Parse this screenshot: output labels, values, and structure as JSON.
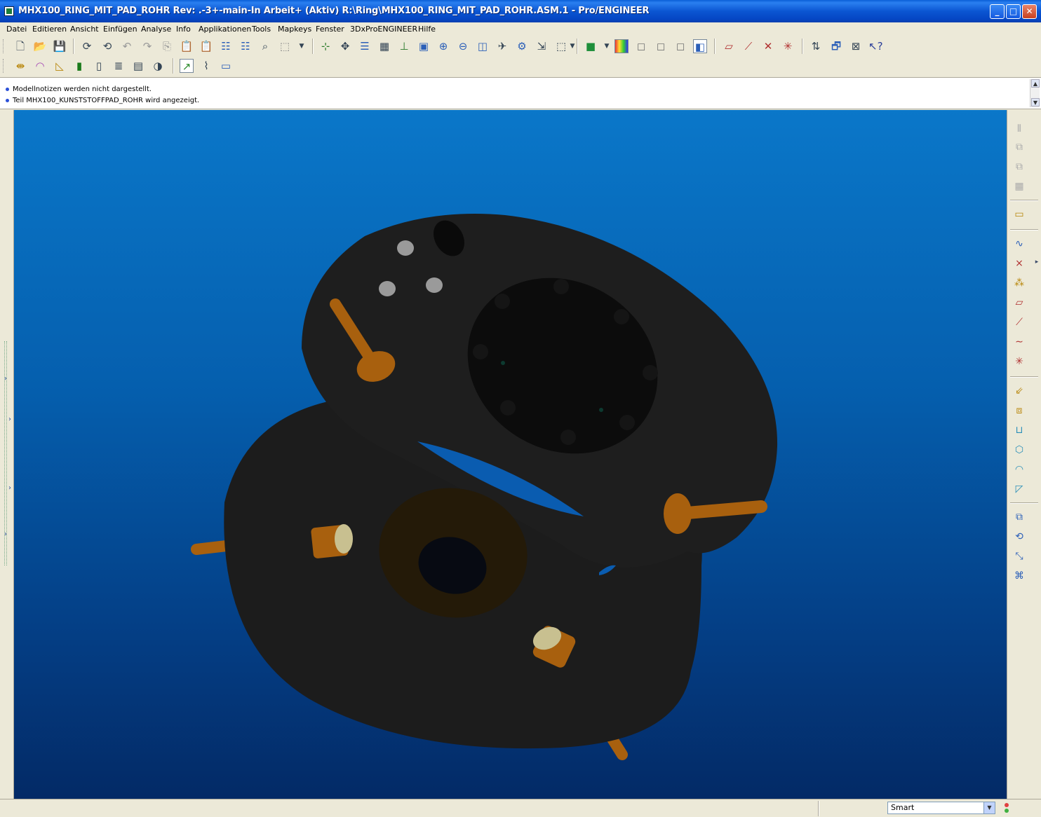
{
  "window": {
    "title": "MHX100_RING_MIT_PAD_ROHR Rev: .-3+-main-In Arbeit+ (Aktiv) R:\\Ring\\MHX100_RING_MIT_PAD_ROHR.ASM.1 - Pro/ENGINEER",
    "minimize": "_",
    "maximize": "□",
    "close": "✕"
  },
  "menu": {
    "items": [
      "Datei",
      "Editieren",
      "Ansicht",
      "Einfügen",
      "Analyse",
      "Info",
      "Applikationen",
      "Tools",
      "Mapkeys",
      "Fenster",
      "3DxProENGINEER",
      "Hilfe"
    ]
  },
  "messages": [
    "Modellnotizen werden nicht dargestellt.",
    "Teil MHX100_KUNSTSTOFFPAD_ROHR wird angezeigt."
  ],
  "statusbar": {
    "filter_value": "Smart",
    "filter_arrow": "▼"
  },
  "colors": {
    "viewport_top": "#0a77c9",
    "viewport_bottom": "#032a66",
    "model_body": "#1c1c1c",
    "pin_color": "#a8600e",
    "nut_color": "#9a9a9a"
  }
}
